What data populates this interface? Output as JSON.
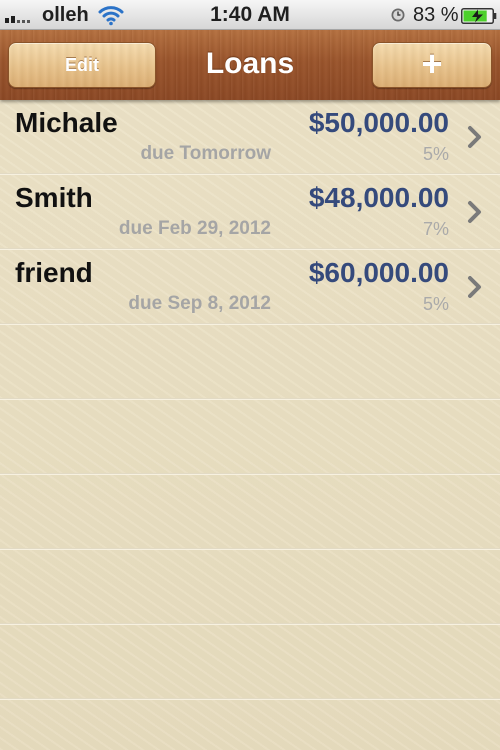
{
  "status_bar": {
    "carrier": "olleh",
    "time": "1:40 AM",
    "battery_percent": "83 %",
    "battery_level": 0.83,
    "icons": [
      "signal-icon",
      "wifi-icon",
      "alarm-icon",
      "battery-charging-icon"
    ]
  },
  "nav": {
    "title": "Loans",
    "edit_label": "Edit",
    "add_label": "+"
  },
  "loans": [
    {
      "name": "Michale",
      "due": "due Tomorrow",
      "amount": "$50,000.00",
      "rate": "5%"
    },
    {
      "name": "Smith",
      "due": "due Feb 29, 2012",
      "amount": "$48,000.00",
      "rate": "7%"
    },
    {
      "name": "friend",
      "due": "due Sep 8, 2012",
      "amount": "$60,000.00",
      "rate": "5%"
    }
  ],
  "colors": {
    "amount": "#354a7c",
    "due_text": "#a5a5a5",
    "nav_wood": "#9a542b",
    "background": "#ece2c6",
    "battery_fill": "#4cd02b"
  }
}
